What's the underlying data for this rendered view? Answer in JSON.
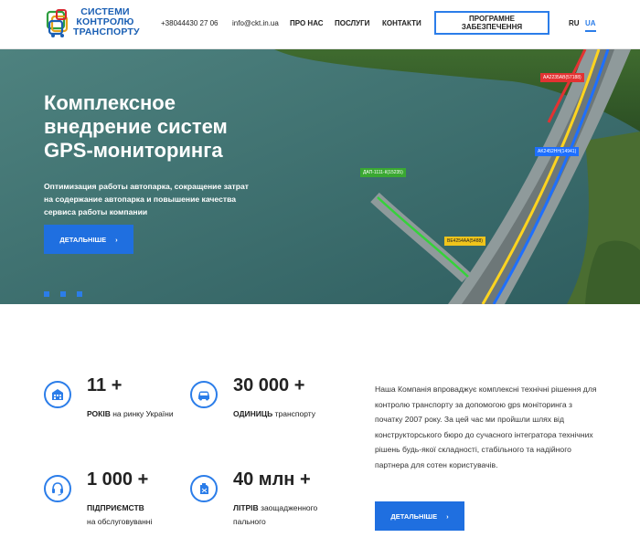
{
  "colors": {
    "accent": "#2b7de9",
    "button": "#1f6fe0"
  },
  "header": {
    "logo_lines": [
      "СИСТЕМИ",
      "КОНТРОЛЮ",
      "ТРАНСПОРТУ"
    ],
    "phone": "+38044430 27 06",
    "email": "info@ckt.in.ua",
    "nav": {
      "about": "ПРО НАС",
      "services": "ПОСЛУГИ",
      "contacts": "КОНТАКТИ"
    },
    "software_button": "ПРОГРАМНЕ ЗАБЕЗПЕЧЕННЯ",
    "lang": {
      "ru": "RU",
      "ua": "UA",
      "active": "UA"
    }
  },
  "hero": {
    "title": "Комплексное\nвнедрение систем\nGPS-мониторинга",
    "subtitle": "Оптимизация работы автопарка, сокращение затрат на содержание автопарка и повышение качества сервиса работы компании",
    "button": "ДЕТАЛЬНІШЕ",
    "button_icon": "chevron-right-icon",
    "slides": 3,
    "map_labels": {
      "red": "AA2235AB(57188)",
      "blue": "AK2452HH(14941)",
      "green": "ДАП-1111-К(15235)",
      "yellow": "BE4254AA(5488)"
    }
  },
  "stats": [
    {
      "icon": "building-icon",
      "number": "11 +",
      "bold": "РОКІВ",
      "rest": "на ринку України"
    },
    {
      "icon": "car-icon",
      "number": "30 000 +",
      "bold": "ОДИНИЦЬ",
      "rest": "транспорту"
    },
    {
      "icon": "headset-icon",
      "number": "1 000 +",
      "bold": "ПІДПРИЄМСТВ",
      "rest": "на обслуговуванні"
    },
    {
      "icon": "fuel-can-icon",
      "number": "40 млн +",
      "bold": "ЛІТРІВ",
      "rest": "заощадженного пального"
    }
  ],
  "about": {
    "text": "Наша Компанія впроваджує комплексні технічні рішення для контролю транспорту за допомогою gps моніторинга з початку 2007 року. За цей час ми пройшли шлях від конструкторського бюро до сучасного інтегратора технічних рішень будь-якої складності, стабільного та надійного партнера для сотен користувачів.",
    "button": "ДЕТАЛЬНІШЕ"
  }
}
